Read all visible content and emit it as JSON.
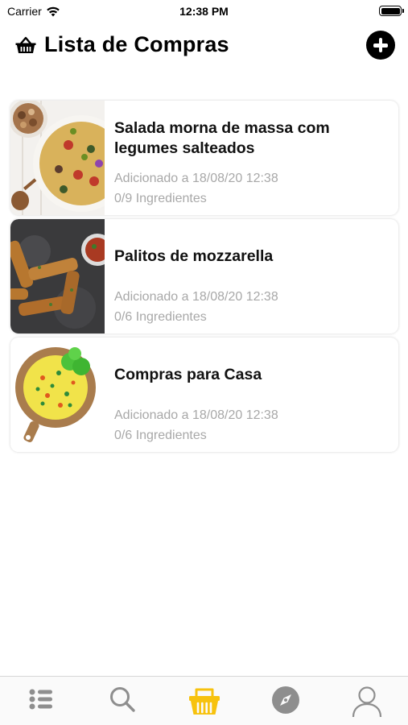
{
  "status_bar": {
    "carrier": "Carrier",
    "time": "12:38 PM",
    "wifi_icon": "wifi-icon",
    "battery_icon": "battery-icon"
  },
  "header": {
    "icon": "basket-icon",
    "title": "Lista de Compras",
    "add_icon": "plus-circle-icon"
  },
  "lists": [
    {
      "title": "Salada morna de massa com legumes salteados",
      "date": "Adicionado a 18/08/20 12:38",
      "ingredients": "0/9 Ingredientes",
      "image": "pasta-salad-photo"
    },
    {
      "title": "Palitos de mozzarella",
      "date": "Adicionado a 18/08/20 12:38",
      "ingredients": "0/6 Ingredientes",
      "image": "mozzarella-sticks-photo"
    },
    {
      "title": "Compras para Casa",
      "date": "Adicionado a 18/08/20 12:38",
      "ingredients": "0/6 Ingredientes",
      "image": "food-plate-illustration"
    }
  ],
  "tab_bar": {
    "tabs": [
      {
        "icon": "list-icon",
        "active": false
      },
      {
        "icon": "search-icon",
        "active": false
      },
      {
        "icon": "basket-icon",
        "active": true
      },
      {
        "icon": "compass-icon",
        "active": false
      },
      {
        "icon": "profile-icon",
        "active": false
      }
    ]
  },
  "colors": {
    "accent": "#f7c20e",
    "tab_inactive": "#8e8e8e",
    "subtext": "#a8a8a8"
  }
}
